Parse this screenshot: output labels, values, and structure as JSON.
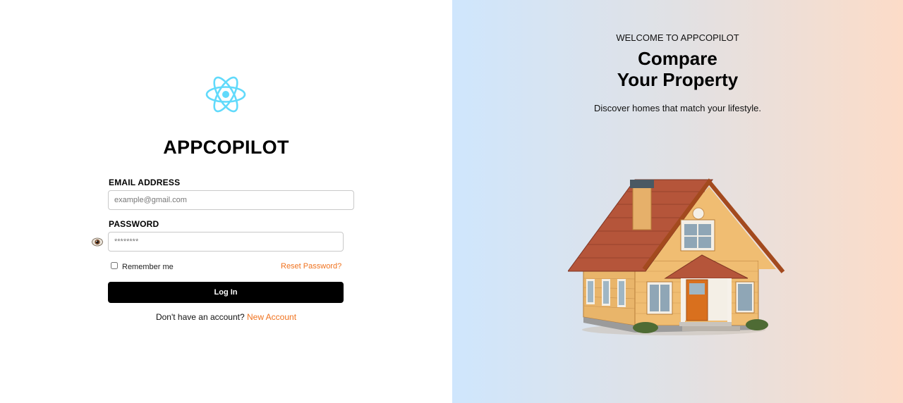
{
  "brand": {
    "name": "APPCOPILOT",
    "logo_icon": "react-atom-icon",
    "logo_color": "#61dafb"
  },
  "login": {
    "email_label": "EMAIL ADDRESS",
    "email_placeholder": "example@gmail.com",
    "email_value": "",
    "password_label": "PASSWORD",
    "password_placeholder": "********",
    "password_value": "",
    "show_password_icon": "eye-icon",
    "remember_label": "Remember me",
    "remember_checked": false,
    "reset_link": "Reset Password?",
    "submit_label": "Log In",
    "signup_prompt": "Don't have an account?",
    "signup_link": "New Account"
  },
  "promo": {
    "eyebrow": "WELCOME TO APPCOPILOT",
    "headline_line1": "Compare",
    "headline_line2": "Your Property",
    "tagline": "Discover homes that match your lifestyle.",
    "image": "house-illustration"
  },
  "colors": {
    "accent": "#f0721e",
    "button_bg": "#000000",
    "gradient_start": "#cfe6fd",
    "gradient_end": "#fcdcc8"
  }
}
